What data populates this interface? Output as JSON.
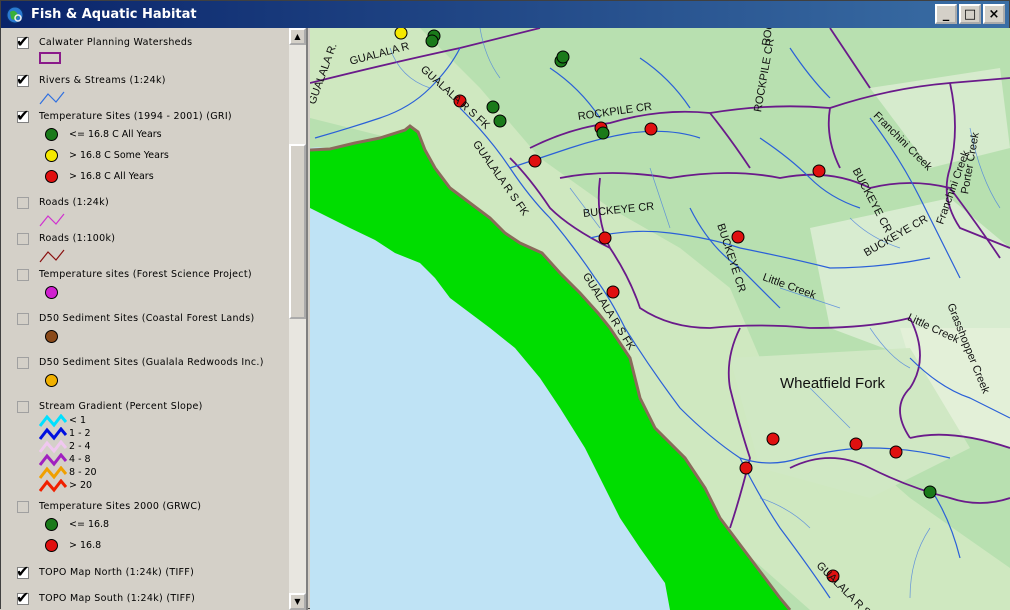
{
  "window": {
    "title": "Fish & Aquatic Habitat",
    "minimize": "_",
    "maximize": "□",
    "close": "×"
  },
  "toc": {
    "layers": [
      {
        "name": "Calwater Planning Watersheds",
        "checked": true
      },
      {
        "name": "Rivers & Streams (1:24k)",
        "checked": true
      },
      {
        "name": "Temperature Sites (1994 - 2001) (GRI)",
        "checked": true,
        "symbols": [
          {
            "label": "<= 16.8 C All Years",
            "color": "#1a7a1a"
          },
          {
            "label": "> 16.8 C Some Years",
            "color": "#f5e800"
          },
          {
            "label": "> 16.8 C All Years",
            "color": "#e01010"
          }
        ]
      },
      {
        "name": "Roads (1:24k)",
        "checked": false
      },
      {
        "name": "Roads (1:100k)",
        "checked": false
      },
      {
        "name": "Temperature sites (Forest Science Project)",
        "checked": false,
        "symbols": [
          {
            "label": "",
            "color": "#d020d0"
          }
        ]
      },
      {
        "name": "D50 Sediment Sites (Coastal Forest Lands)",
        "checked": false,
        "symbols": [
          {
            "label": "",
            "color": "#8a4a1a"
          }
        ]
      },
      {
        "name": "D50 Sediment Sites (Gualala Redwoods Inc.)",
        "checked": false,
        "symbols": [
          {
            "label": "",
            "color": "#f0b000"
          }
        ]
      },
      {
        "name": "Stream Gradient (Percent Slope)",
        "checked": false,
        "gradient": [
          {
            "label": "< 1",
            "color": "#00e0ff"
          },
          {
            "label": "1 - 2",
            "color": "#0010e0"
          },
          {
            "label": "2 - 4",
            "color": "#f0c8f0"
          },
          {
            "label": "4 - 8",
            "color": "#a020c0"
          },
          {
            "label": "8 - 20",
            "color": "#f0a000"
          },
          {
            "label": "> 20",
            "color": "#f02000"
          }
        ]
      },
      {
        "name": "Temperature Sites 2000 (GRWC)",
        "checked": false,
        "symbols": [
          {
            "label": "<= 16.8",
            "color": "#1a7a1a"
          },
          {
            "label": "> 16.8",
            "color": "#e01010"
          }
        ]
      },
      {
        "name": "TOPO Map North (1:24k) (TIFF)",
        "checked": true
      },
      {
        "name": "TOPO Map South (1:24k) (TIFF)",
        "checked": true
      }
    ]
  },
  "map": {
    "labels": {
      "gualala_r": "GUALALA R.",
      "gualala_rs_fk_1": "GUALALA R S FK",
      "gualala_rs_fk_2": "GUALALA R S FK",
      "gualala_rs_fk_3": "GUALALA R S FK",
      "gualala_rs_fk_4": "GUALALA R S",
      "gualala_short": "GUALALA R",
      "rockpile_cr": "ROCKPILE CR",
      "rockpile_cr_v": "ROCKPILE CR",
      "roc": "ROC",
      "buckeye_cr_1": "BUCKEYE CR",
      "buckeye_cr_2": "BUCKEYE CR",
      "buckeye_cr_3": "BUCKEYE CR",
      "buckeye_cr_4": "BUCKEYE CR",
      "franchini_creek_1": "Franchini Creek",
      "franchini_creek_2": "Franchini Creek",
      "little_creek_1": "Little Creek",
      "little_creek_2": "Little Creek",
      "porter_creek": "Porter Creek",
      "grasshopper_creek": "Grasshopper Creek",
      "wheatfield_fork": "Wheatfield Fork"
    },
    "colors": {
      "ocean": "#bfe3f5",
      "coast_land": "#00dd00",
      "coast_border": "#8b6a5a",
      "terrain": "#b8e0b0",
      "stream": "#2a60d8",
      "watershed": "#6a1a8a"
    }
  }
}
